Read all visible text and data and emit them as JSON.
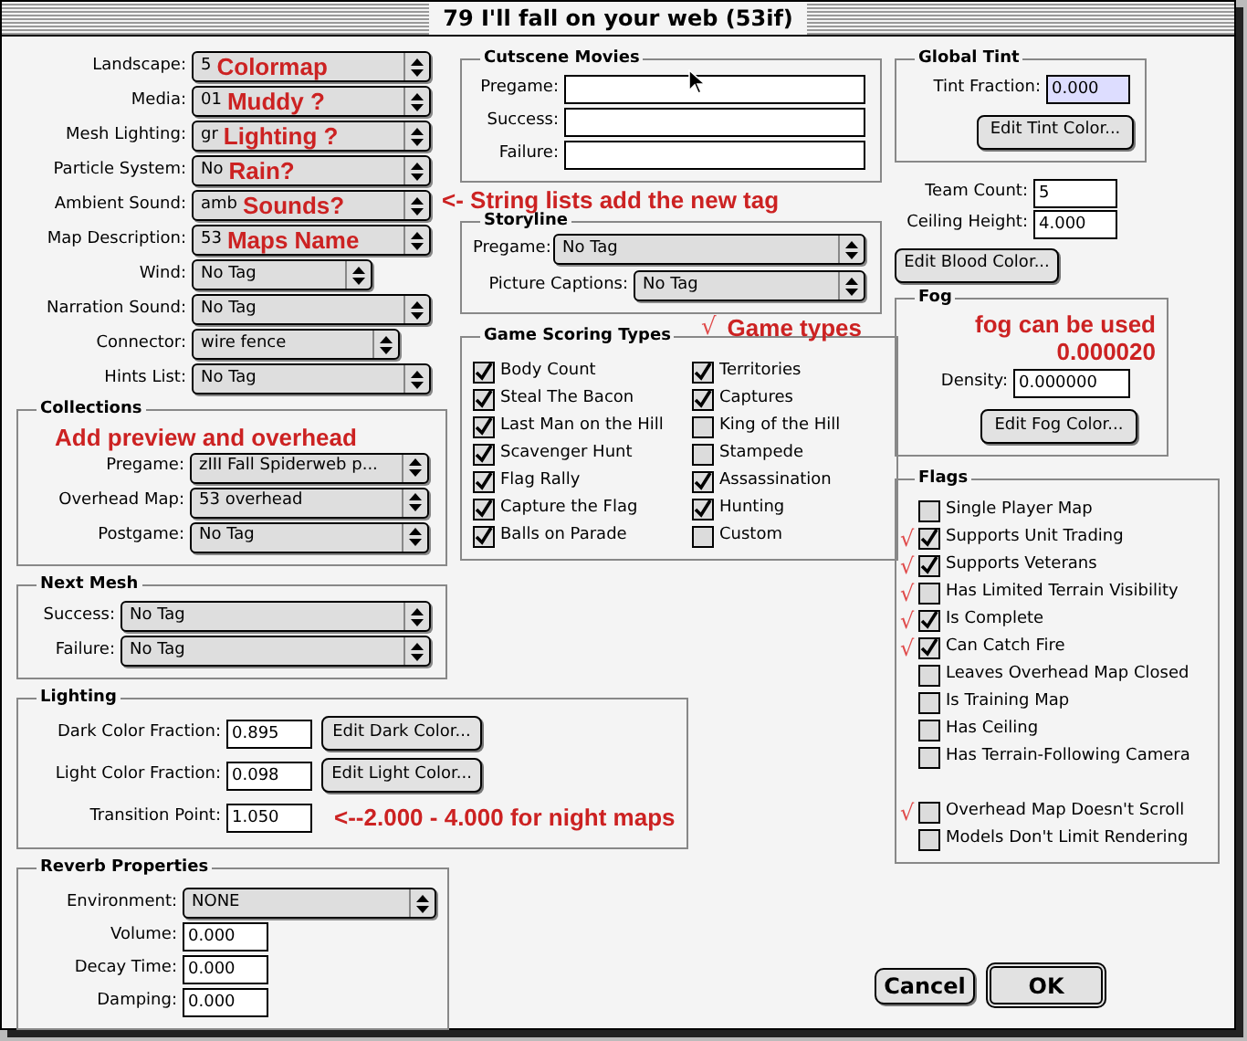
{
  "window": {
    "title": "79 I'll fall on your web (53if)"
  },
  "main_fields": [
    {
      "label": "Landscape:",
      "value": "5",
      "note": "Colormap"
    },
    {
      "label": "Media:",
      "value": "01",
      "note": "Muddy ?"
    },
    {
      "label": "Mesh Lighting:",
      "value": "gr",
      "note": "Lighting ?"
    },
    {
      "label": "Particle System:",
      "value": "No",
      "note": "Rain?"
    },
    {
      "label": "Ambient Sound:",
      "value": "amb",
      "note": "Sounds?"
    },
    {
      "label": "Map Description:",
      "value": "53",
      "note": "Maps Name"
    },
    {
      "label": "Wind:",
      "value": "No Tag"
    },
    {
      "label": "Narration Sound:",
      "value": "No Tag"
    },
    {
      "label": "Connector:",
      "value": "wire fence"
    },
    {
      "label": "Hints List:",
      "value": "No Tag"
    }
  ],
  "collections": {
    "title": "Collections",
    "note": "Add preview and overhead",
    "fields": [
      {
        "label": "Pregame:",
        "value": "zIII Fall Spiderweb p..."
      },
      {
        "label": "Overhead Map:",
        "value": "53 overhead"
      },
      {
        "label": "Postgame:",
        "value": "No Tag"
      }
    ]
  },
  "next_mesh": {
    "title": "Next Mesh",
    "fields": [
      {
        "label": "Success:",
        "value": "No Tag"
      },
      {
        "label": "Failure:",
        "value": "No Tag"
      }
    ]
  },
  "lighting": {
    "title": "Lighting",
    "fields": [
      {
        "label": "Dark Color Fraction:",
        "value": "0.895",
        "button": "Edit Dark Color..."
      },
      {
        "label": "Light Color Fraction:",
        "value": "0.098",
        "button": "Edit Light Color..."
      },
      {
        "label": "Transition Point:",
        "value": "1.050",
        "note": "<--2.000 - 4.000 for night maps"
      }
    ]
  },
  "reverb": {
    "title": "Reverb Properties",
    "environment": {
      "label": "Environment:",
      "value": "NONE"
    },
    "fields": [
      {
        "label": "Volume:",
        "value": "0.000"
      },
      {
        "label": "Decay Time:",
        "value": "0.000"
      },
      {
        "label": "Damping:",
        "value": "0.000"
      }
    ]
  },
  "cutscene_movies": {
    "title": "Cutscene Movies",
    "fields": [
      {
        "label": "Pregame:"
      },
      {
        "label": "Success:"
      },
      {
        "label": "Failure:"
      }
    ]
  },
  "storyline": {
    "title": "Storyline",
    "note": "<- String lists add the new tag",
    "fields": [
      {
        "label": "Pregame:",
        "value": "No Tag"
      },
      {
        "label": "Picture Captions:",
        "value": "No Tag"
      }
    ]
  },
  "game_scoring": {
    "title": "Game Scoring Types",
    "tick": "√",
    "note": "Game types",
    "types": [
      {
        "label": "Body Count",
        "checked": true
      },
      {
        "label": "Steal The Bacon",
        "checked": true
      },
      {
        "label": "Last Man on the Hill",
        "checked": true
      },
      {
        "label": "Scavenger Hunt",
        "checked": true
      },
      {
        "label": "Flag Rally",
        "checked": true
      },
      {
        "label": "Capture the Flag",
        "checked": true
      },
      {
        "label": "Balls on Parade",
        "checked": true
      },
      {
        "label": "Territories",
        "checked": true
      },
      {
        "label": "Captures",
        "checked": true
      },
      {
        "label": "King of the Hill",
        "checked": false
      },
      {
        "label": "Stampede",
        "checked": false
      },
      {
        "label": "Assassination",
        "checked": true
      },
      {
        "label": "Hunting",
        "checked": true
      },
      {
        "label": "Custom",
        "checked": false
      }
    ]
  },
  "global_tint": {
    "title": "Global Tint",
    "label": "Tint Fraction:",
    "value": "0.000",
    "button": "Edit Tint Color..."
  },
  "team_count": {
    "label": "Team Count:",
    "value": "5"
  },
  "ceiling_height": {
    "label": "Ceiling Height:",
    "value": "4.000"
  },
  "blood_button": "Edit Blood Color...",
  "fog": {
    "title": "Fog",
    "notes": [
      "fog can be used",
      "0.000020"
    ],
    "label": "Density:",
    "value": "0.000000",
    "button": "Edit Fog Color..."
  },
  "flags": {
    "title": "Flags",
    "tick": "√",
    "items": [
      {
        "label": "Single Player Map",
        "checked": false,
        "marked": false
      },
      {
        "label": "Supports Unit Trading",
        "checked": true,
        "marked": true
      },
      {
        "label": "Supports Veterans",
        "checked": true,
        "marked": true
      },
      {
        "label": "Has Limited Terrain Visibility",
        "checked": false,
        "marked": true
      },
      {
        "label": "Is Complete",
        "checked": true,
        "marked": true
      },
      {
        "label": "Can Catch Fire",
        "checked": true,
        "marked": true
      },
      {
        "label": "Leaves Overhead Map Closed",
        "checked": false,
        "marked": false
      },
      {
        "label": "Is Training Map",
        "checked": false,
        "marked": false
      },
      {
        "label": "Has Ceiling",
        "checked": false,
        "marked": false
      },
      {
        "label": "Has Terrain-Following Camera",
        "checked": false,
        "marked": false
      },
      {
        "label": "Overhead Map Doesn't Scroll",
        "checked": false,
        "marked": true
      },
      {
        "label": "Models Don't Limit Rendering",
        "checked": false,
        "marked": false
      }
    ]
  },
  "buttons": [
    {
      "label": "Cancel",
      "default": false
    },
    {
      "label": "OK",
      "default": true
    }
  ]
}
